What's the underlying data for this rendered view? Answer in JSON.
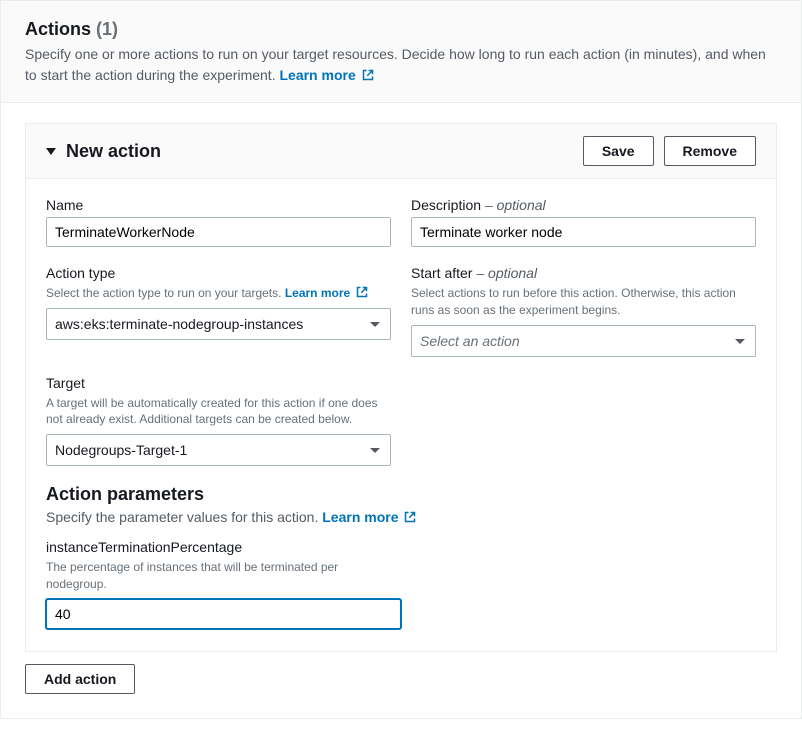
{
  "header": {
    "title": "Actions",
    "count": "(1)",
    "desc": "Specify one or more actions to run on your target resources. Decide how long to run each action (in minutes), and when to start the action during the experiment.",
    "learn_more": "Learn more"
  },
  "panel": {
    "title": "New action",
    "save": "Save",
    "remove": "Remove"
  },
  "name": {
    "label": "Name",
    "value": "TerminateWorkerNode"
  },
  "description": {
    "label": "Description",
    "optional": " – optional",
    "value": "Terminate worker node"
  },
  "action_type": {
    "label": "Action type",
    "helper": "Select the action type to run on your targets.",
    "learn_more": "Learn more",
    "value": "aws:eks:terminate-nodegroup-instances"
  },
  "start_after": {
    "label": "Start after",
    "optional": " – optional",
    "helper": "Select actions to run before this action. Otherwise, this action runs as soon as the experiment begins.",
    "placeholder": "Select an action"
  },
  "target": {
    "label": "Target",
    "helper": "A target will be automatically created for this action if one does not already exist. Additional targets can be created below.",
    "value": "Nodegroups-Target-1"
  },
  "params": {
    "title": "Action parameters",
    "desc": "Specify the parameter values for this action.",
    "learn_more": "Learn more",
    "pct_label": "instanceTerminationPercentage",
    "pct_helper": "The percentage of instances that will be terminated per nodegroup.",
    "pct_value": "40"
  },
  "add_action": "Add action"
}
